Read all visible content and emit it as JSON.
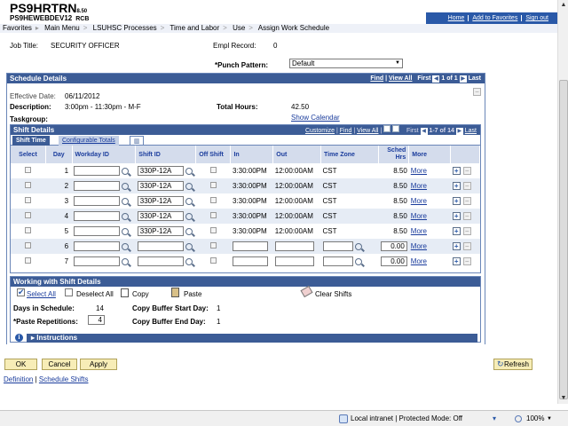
{
  "header": {
    "brand": "PS9HRTRN",
    "brand_version": "8.50",
    "db": "PS9HEWEBDEV12",
    "db_tag": "RCB",
    "links": [
      "Home",
      "Add to Favorites",
      "Sign out"
    ]
  },
  "breadcrumbs": [
    "Favorites",
    "Main Menu",
    "LSUHSC Processes",
    "Time and Labor",
    "Use",
    "Assign Work Schedule"
  ],
  "job": {
    "job_title_label": "Job Title:",
    "job_title": "SECURITY OFFICER",
    "empl_record_label": "Empl Record:",
    "empl_record": "0",
    "punch_pattern_label": "*Punch Pattern:",
    "punch_pattern": "Default"
  },
  "schedule": {
    "title": "Schedule Details",
    "nav_find": "Find",
    "nav_view_all": "View All",
    "nav_first": "First",
    "nav_range": "1 of 1",
    "nav_last": "Last",
    "effective_date_label": "Effective Date:",
    "effective_date": "06/11/2012",
    "description_label": "Description:",
    "description": "3:00pm - 11:30pm - M-F",
    "total_hours_label": "Total Hours:",
    "total_hours": "42.50",
    "show_calendar": "Show Calendar",
    "taskgroup_label": "Taskgroup:"
  },
  "shift": {
    "title": "Shift Details",
    "nav_customize": "Customize",
    "nav_find": "Find",
    "nav_view_all": "View All",
    "nav_first": "First",
    "nav_range": "1-7 of 14",
    "nav_last": "Last",
    "tab_shift_time": "Shift Time",
    "tab_configurable": "Configurable Totals",
    "headers": {
      "select": "Select",
      "day": "Day",
      "workday_id": "Workday ID",
      "shift_id": "Shift ID",
      "off_shift": "Off Shift",
      "in": "In",
      "out": "Out",
      "time_zone": "Time Zone",
      "sched_hrs": "Sched Hrs",
      "more": "More"
    },
    "rows": [
      {
        "day": "1",
        "shift_id": "330P-12A",
        "in": "3:30:00PM",
        "out": "12:00:00AM",
        "tz": "CST",
        "hrs": "8.50",
        "more": "More"
      },
      {
        "day": "2",
        "shift_id": "330P-12A",
        "in": "3:30:00PM",
        "out": "12:00:00AM",
        "tz": "CST",
        "hrs": "8.50",
        "more": "More"
      },
      {
        "day": "3",
        "shift_id": "330P-12A",
        "in": "3:30:00PM",
        "out": "12:00:00AM",
        "tz": "CST",
        "hrs": "8.50",
        "more": "More"
      },
      {
        "day": "4",
        "shift_id": "330P-12A",
        "in": "3:30:00PM",
        "out": "12:00:00AM",
        "tz": "CST",
        "hrs": "8.50",
        "more": "More"
      },
      {
        "day": "5",
        "shift_id": "330P-12A",
        "in": "3:30:00PM",
        "out": "12:00:00AM",
        "tz": "CST",
        "hrs": "8.50",
        "more": "More"
      },
      {
        "day": "6",
        "shift_id": "",
        "in": "",
        "out": "",
        "tz": "",
        "hrs": "0.00",
        "more": "More"
      },
      {
        "day": "7",
        "shift_id": "",
        "in": "",
        "out": "",
        "tz": "",
        "hrs": "0.00",
        "more": "More"
      }
    ]
  },
  "working": {
    "title": "Working with Shift Details",
    "select_all": "Select All",
    "deselect_all": "Deselect All",
    "copy": "Copy",
    "paste": "Paste",
    "clear_shifts": "Clear Shifts",
    "days_in_schedule_label": "Days in Schedule:",
    "days_in_schedule": "14",
    "paste_reps_label": "*Paste Repetitions:",
    "paste_reps": "4",
    "copy_start_label": "Copy Buffer Start Day:",
    "copy_start": "1",
    "copy_end_label": "Copy Buffer End Day:",
    "copy_end": "1",
    "instructions": "Instructions"
  },
  "buttons": {
    "ok": "OK",
    "cancel": "Cancel",
    "apply": "Apply",
    "refresh": "Refresh"
  },
  "bottom_links": {
    "definition": "Definition",
    "schedule_shifts": "Schedule Shifts"
  },
  "statusbar": {
    "zone": "Local intranet | Protected Mode: Off",
    "zoom": "100%"
  }
}
